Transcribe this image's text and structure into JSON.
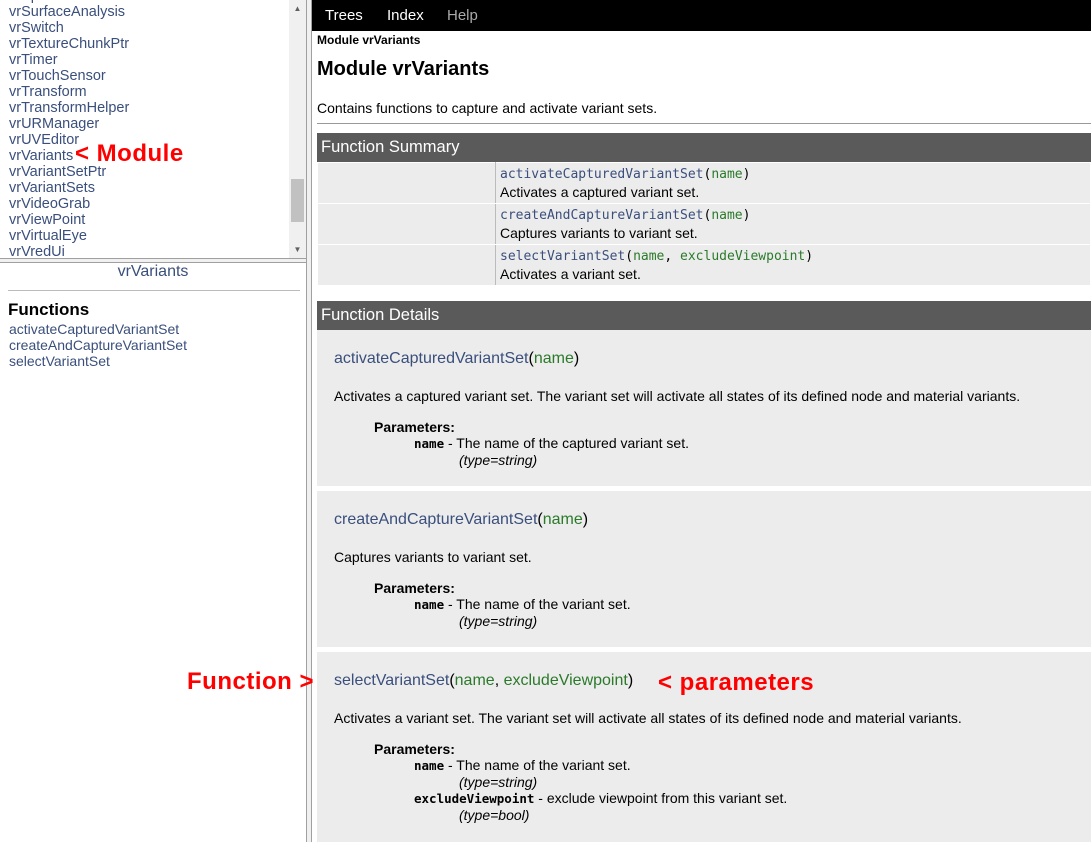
{
  "module_list": {
    "items": [
      "vrSpaceMouseButton",
      "vrSurfaceAnalysis",
      "vrSwitch",
      "vrTextureChunkPtr",
      "vrTimer",
      "vrTouchSensor",
      "vrTransform",
      "vrTransformHelper",
      "vrURManager",
      "vrUVEditor",
      "vrVariants",
      "vrVariantSetPtr",
      "vrVariantSets",
      "vrVideoGrab",
      "vrViewPoint",
      "vrVirtualEye",
      "vrVredUi"
    ]
  },
  "module_toc": {
    "title": "vrVariants",
    "functions_heading": "Functions",
    "functions": [
      "activateCapturedVariantSet",
      "createAndCaptureVariantSet",
      "selectVariantSet"
    ]
  },
  "navbar": {
    "trees": "Trees",
    "index": "Index",
    "help": "Help"
  },
  "main": {
    "breadcrumb": "Module vrVariants",
    "title": "Module vrVariants",
    "description": "Contains functions to capture and activate variant sets.",
    "summary_header": "Function Summary",
    "details_header": "Function Details",
    "summary": [
      {
        "name": "activateCapturedVariantSet",
        "params": [
          "name"
        ],
        "desc": "Activates a captured variant set."
      },
      {
        "name": "createAndCaptureVariantSet",
        "params": [
          "name"
        ],
        "desc": "Captures variants to variant set."
      },
      {
        "name": "selectVariantSet",
        "params": [
          "name",
          "excludeViewpoint"
        ],
        "desc": "Activates a variant set."
      }
    ],
    "details": [
      {
        "name": "activateCapturedVariantSet",
        "params": [
          "name"
        ],
        "description": "Activates a captured variant set. The variant set will activate all states of its defined node and material variants.",
        "params_label": "Parameters:",
        "param_list": [
          {
            "name": "name",
            "desc": " - The name of the captured variant set.",
            "type": "(type=string)"
          }
        ]
      },
      {
        "name": "createAndCaptureVariantSet",
        "params": [
          "name"
        ],
        "description": "Captures variants to variant set.",
        "params_label": "Parameters:",
        "param_list": [
          {
            "name": "name",
            "desc": " - The name of the variant set.",
            "type": "(type=string)"
          }
        ]
      },
      {
        "name": "selectVariantSet",
        "params": [
          "name",
          "excludeViewpoint"
        ],
        "description": "Activates a variant set. The variant set will activate all states of its defined node and material variants.",
        "params_label": "Parameters:",
        "param_list": [
          {
            "name": "name",
            "desc": " - The name of the variant set.",
            "type": "(type=string)"
          },
          {
            "name": "excludeViewpoint",
            "desc": " - exclude viewpoint from this variant set.",
            "type": "(type=bool)"
          }
        ]
      }
    ]
  },
  "annotations": {
    "module": "< Module",
    "function": "Function >",
    "parameters": "< parameters"
  },
  "colors": {
    "link": "#3a4f7c",
    "param": "#2a7a2a",
    "annotation": "#ff0000",
    "section_header": "#5a5a5a",
    "detail_bg": "#ececec"
  },
  "icons": {
    "scroll_up": "scroll-up-arrow-icon",
    "scroll_down": "scroll-down-arrow-icon"
  }
}
